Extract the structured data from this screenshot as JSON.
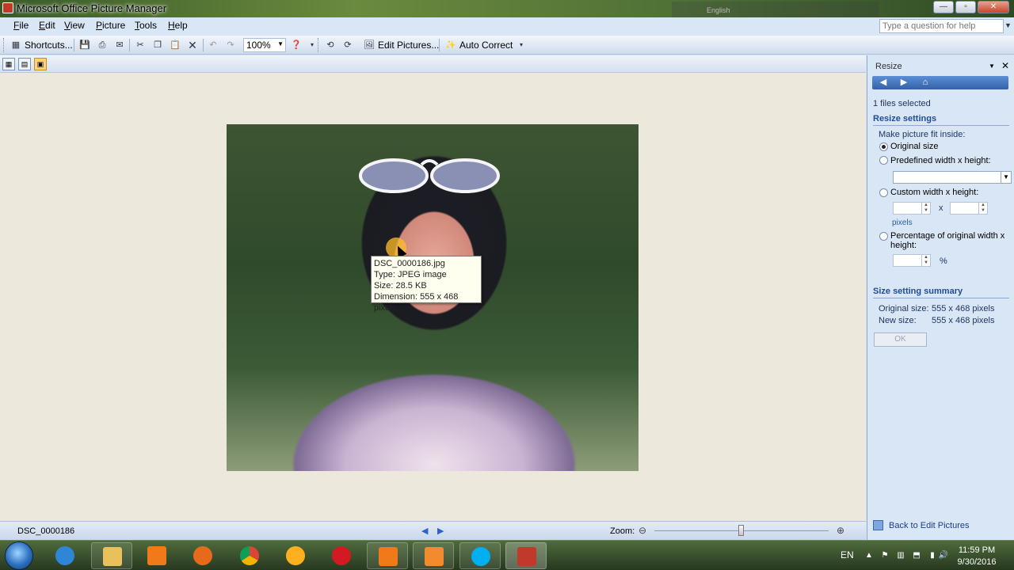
{
  "window": {
    "title": "Microsoft Office Picture Manager",
    "language_bar": "English",
    "minimize": "—",
    "maximize": "▫",
    "close": "✕"
  },
  "menu": {
    "items": [
      {
        "label": "File",
        "u": "F",
        "rest": "ile"
      },
      {
        "label": "Edit",
        "u": "E",
        "rest": "dit"
      },
      {
        "label": "View",
        "u": "V",
        "rest": "iew"
      },
      {
        "label": "Picture",
        "u": "P",
        "rest": "icture"
      },
      {
        "label": "Tools",
        "u": "T",
        "rest": "ools"
      },
      {
        "label": "Help",
        "u": "H",
        "rest": "elp"
      }
    ],
    "help_placeholder": "Type a question for help"
  },
  "toolbar": {
    "shortcuts": "Shortcuts...",
    "zoom_value": "100%",
    "edit_pictures": "Edit Pictures...",
    "auto_correct": "Auto Correct"
  },
  "tooltip": {
    "name": "DSC_0000186.jpg",
    "type": "Type: JPEG image",
    "size": "Size: 28.5 KB",
    "dimension": "Dimension: 555 x 468 pixels"
  },
  "status": {
    "filename": "DSC_0000186",
    "zoom_label": "Zoom:",
    "zoom_level": 0.5
  },
  "pane": {
    "title": "Resize",
    "files_selected": "1 files selected",
    "settings_heading": "Resize settings",
    "fit_label": "Make picture fit inside:",
    "options": {
      "original": "Original size",
      "predefined": "Predefined width x height:",
      "custom": "Custom width x height:",
      "percentage": "Percentage of original width x height:"
    },
    "selected_option": "original",
    "x_label": "x",
    "pixels_label": "pixels",
    "percent_label": "%",
    "summary_heading": "Size setting summary",
    "original_size_label": "Original size:",
    "original_size_value": "555 x 468 pixels",
    "new_size_label": "New size:",
    "new_size_value": "555 x 468 pixels",
    "ok": "OK",
    "back_link": "Back to Edit Pictures"
  },
  "taskbar": {
    "lang": "EN",
    "time": "11:59 PM",
    "date": "9/30/2016",
    "apps": [
      "internet-explorer-icon",
      "file-explorer-icon",
      "media-player-icon",
      "firefox-icon",
      "chrome-icon",
      "yahoo-messenger-icon",
      "opera-icon",
      "camtasia-recorder-icon",
      "camtasia-icon",
      "skype-icon",
      "picture-manager-icon"
    ]
  },
  "colors": {
    "accent": "#1f4d92",
    "canvas": "#ede8dc",
    "pane": "#d9e6f6"
  }
}
